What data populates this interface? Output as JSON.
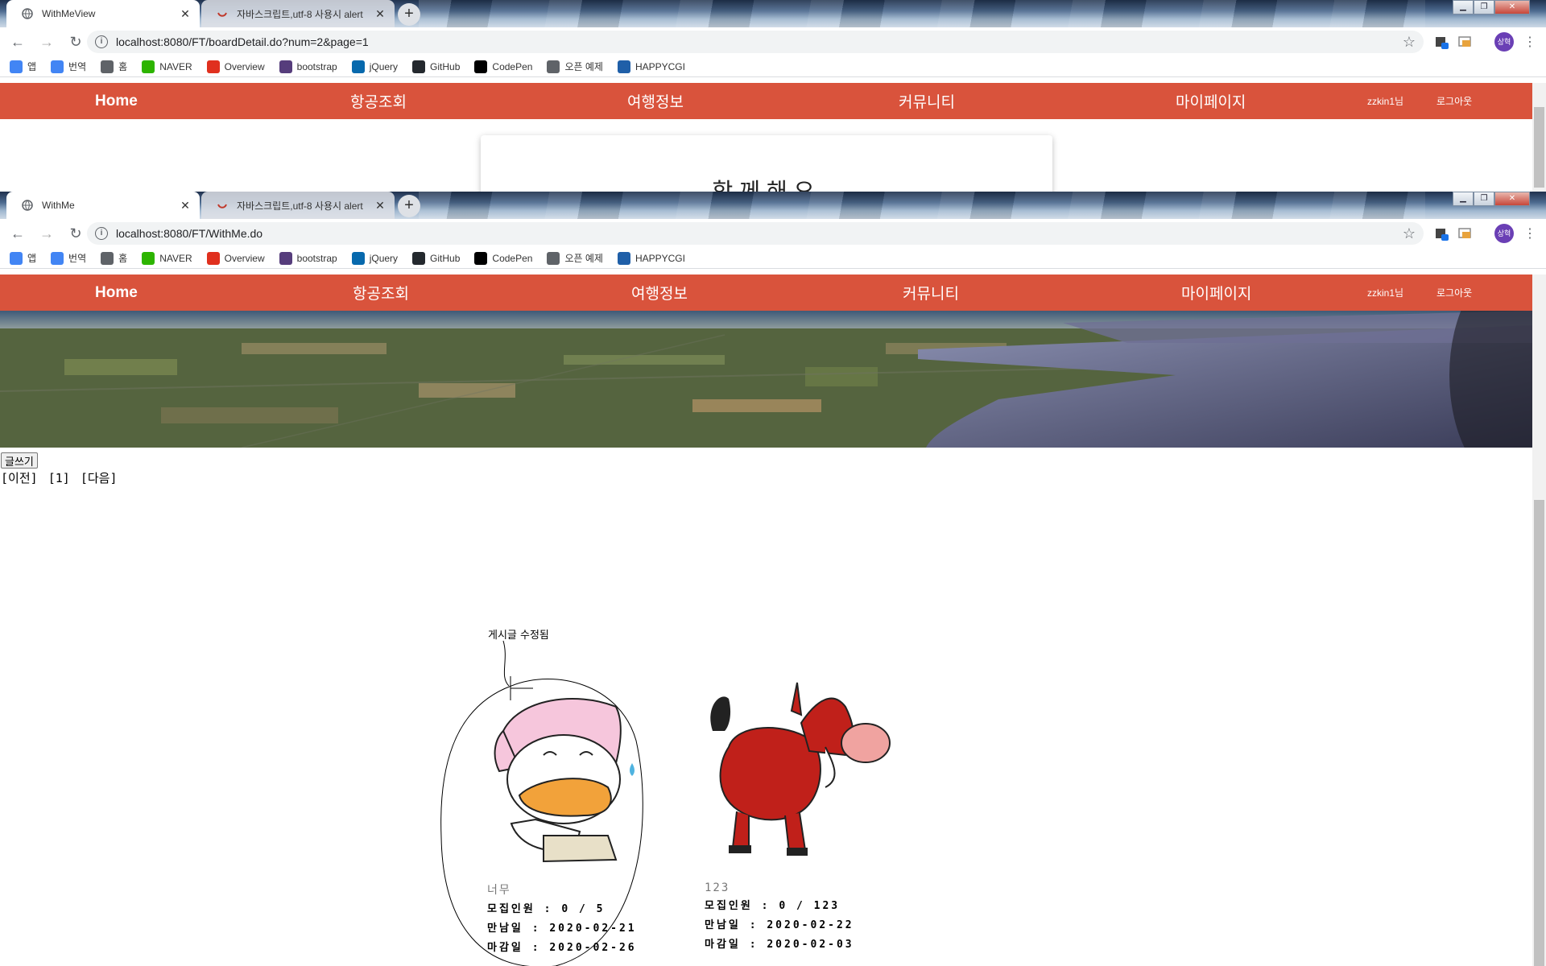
{
  "window1": {
    "tabs": [
      {
        "title": "WithMeView",
        "close": "✕"
      },
      {
        "title": "자바스크립트,utf-8 사용시 alert",
        "close": "✕"
      }
    ],
    "url": "localhost:8080/FT/boardDetail.do?num=2&page=1",
    "card_title": "함께해요"
  },
  "window2": {
    "tabs": [
      {
        "title": "WithMe",
        "close": "✕"
      },
      {
        "title": "자바스크립트,utf-8 사용시 alert",
        "close": "✕"
      }
    ],
    "url": "localhost:8080/FT/WithMe.do"
  },
  "newtab": "+",
  "avatar_text": "상혁",
  "bookmarks": [
    {
      "label": "앱",
      "icon": "apps-grid-icon",
      "color": "#4285f4"
    },
    {
      "label": "번역",
      "icon": "translate-icon",
      "color": "#4285f4"
    },
    {
      "label": "홈",
      "icon": "globe-icon",
      "color": "#5f6368"
    },
    {
      "label": "NAVER",
      "icon": "naver-icon",
      "color": "#2db400"
    },
    {
      "label": "Overview",
      "icon": "oracle-icon",
      "color": "#e0301e"
    },
    {
      "label": "bootstrap",
      "icon": "bootstrap-icon",
      "color": "#563d7c"
    },
    {
      "label": "jQuery",
      "icon": "jquery-icon",
      "color": "#0769ad"
    },
    {
      "label": "GitHub",
      "icon": "github-icon",
      "color": "#24292e"
    },
    {
      "label": "CodePen",
      "icon": "codepen-icon",
      "color": "#000000"
    },
    {
      "label": "오픈 예제",
      "icon": "globe-icon",
      "color": "#5f6368"
    },
    {
      "label": "HAPPYCGI",
      "icon": "happycgi-icon",
      "color": "#1f5fa8"
    }
  ],
  "site_nav": {
    "home": "Home",
    "flights": "항공조회",
    "travel": "여행정보",
    "community": "커뮤니티",
    "mypage": "마이페이지",
    "user": "zzkin1님",
    "logout": "로그아웃"
  },
  "board": {
    "write_button": "글쓰기",
    "prev": "[이전]",
    "page": "[1]",
    "next": "[다음]",
    "annotation": "게시글 수정됨"
  },
  "posts": [
    {
      "title": "너무",
      "recruit": "모집인원 : 0 / 5",
      "meet": "만남일 : 2020-02-21",
      "deadline": "마감일 : 2020-02-26",
      "image": "duck-character"
    },
    {
      "title": "123",
      "recruit": "모집인원 : 0 / 123",
      "meet": "만남일 : 2020-02-22",
      "deadline": "마감일 : 2020-02-03",
      "image": "warthog-character"
    }
  ],
  "colors": {
    "header": "#d9533c",
    "avatar": "#6a3fb5"
  }
}
